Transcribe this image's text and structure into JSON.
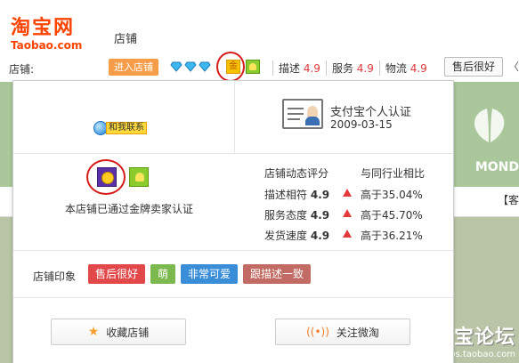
{
  "logo": {
    "cn": "淘宝网",
    "en": "Taobao.com"
  },
  "page_title": "店铺",
  "shop_bar": {
    "label": "店铺:",
    "enter_button": "进入店铺",
    "gold_badge": "金",
    "scores": [
      {
        "label": "描述",
        "value": "4.9"
      },
      {
        "label": "服务",
        "value": "4.9"
      },
      {
        "label": "物流",
        "value": "4.9"
      }
    ],
    "after_sale_button": "售后很好"
  },
  "popup": {
    "contact_button": "和我联系",
    "alipay": {
      "title": "支付宝个人认证",
      "date": "2009-03-15"
    },
    "gold_certified_text": "本店铺已通过金牌卖家认证",
    "rating_header": "店铺动态评分",
    "compare_header": "与同行业相比",
    "ratings": [
      {
        "label": "描述相符",
        "score": "4.9",
        "compare": "高于35.04%"
      },
      {
        "label": "服务态度",
        "score": "4.9",
        "compare": "高于45.70%"
      },
      {
        "label": "发货速度",
        "score": "4.9",
        "compare": "高于36.21%"
      }
    ],
    "tags_label": "店铺印象",
    "tags": [
      {
        "text": "售后很好",
        "color": "#e2474a"
      },
      {
        "text": "萌",
        "color": "#7bb84d"
      },
      {
        "text": "非常可爱",
        "color": "#3a8ed8"
      },
      {
        "text": "跟描述一致",
        "color": "#c26b64"
      }
    ],
    "favorite_button": "收藏店铺",
    "follow_button": "关注微淘"
  },
  "background": {
    "right_tab": "【客",
    "mond_text": "MOND"
  },
  "watermark": {
    "title": "淘宝论坛",
    "url": "bbs.taobao.com"
  }
}
